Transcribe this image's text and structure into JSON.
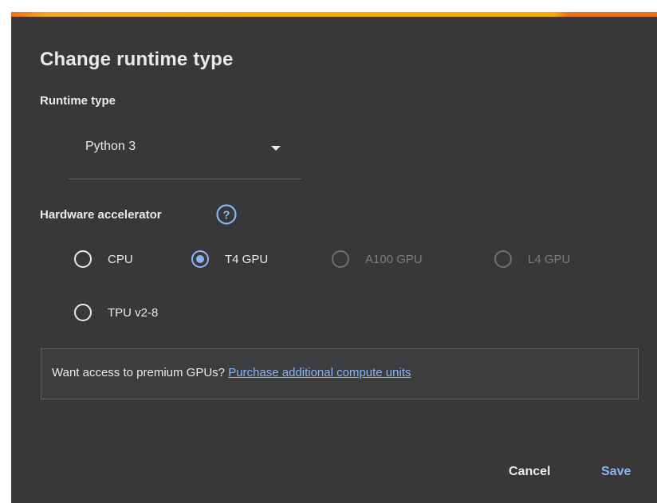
{
  "dialog": {
    "title": "Change runtime type",
    "runtime_type_label": "Runtime type",
    "runtime_type_value": "Python 3",
    "hardware_accelerator_label": "Hardware accelerator",
    "accelerators": [
      {
        "label": "CPU",
        "checked": false,
        "disabled": false
      },
      {
        "label": "T4 GPU",
        "checked": true,
        "disabled": false
      },
      {
        "label": "A100 GPU",
        "checked": false,
        "disabled": true
      },
      {
        "label": "L4 GPU",
        "checked": false,
        "disabled": true
      },
      {
        "label": "TPU v2-8",
        "checked": false,
        "disabled": false
      }
    ],
    "notice_text": "Want access to premium GPUs?",
    "notice_link": "Purchase additional compute units",
    "cancel_label": "Cancel",
    "save_label": "Save"
  },
  "colors": {
    "background": "#383838",
    "accent": "#8ab4f8",
    "top_bar": "#f9ab00"
  }
}
